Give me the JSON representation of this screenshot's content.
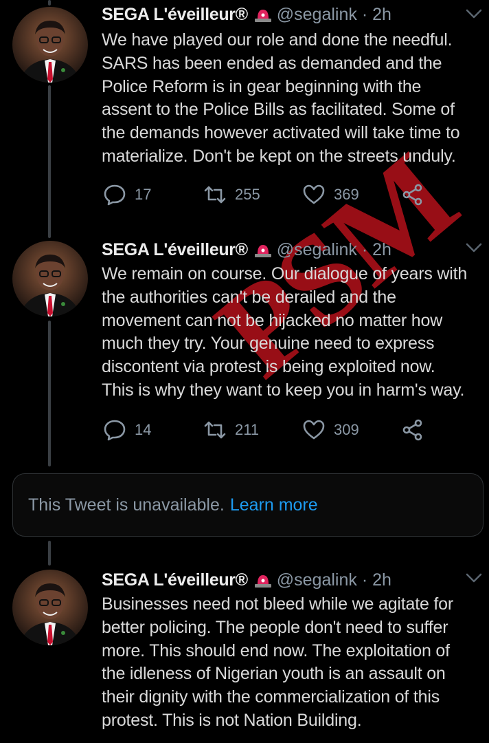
{
  "tweets": [
    {
      "name": "SEGA L'éveilleur®",
      "handle": "@segalink",
      "separator": "·",
      "time": "2h",
      "lines": [
        "We have played our role and done the needful.",
        "SARS has been ended as demanded and the",
        "Police Reform is in gear beginning with the",
        "assent to the Police Bills as facilitated. Some of",
        "the demands however activated will take time to",
        "materialize. Don't be kept on the streets unduly."
      ],
      "replies": "17",
      "retweets": "255",
      "likes": "369"
    },
    {
      "name": "SEGA L'éveilleur®",
      "handle": "@segalink",
      "separator": "·",
      "time": "2h",
      "lines": [
        "We remain on course. Our dialogue of years with",
        "the authorities can't be derailed and the",
        "movement can not be hijacked no matter how",
        "much they try. Your genuine need to express",
        "discontent via protest is being exploited now.",
        "This is why they want to keep you in harm's way."
      ],
      "replies": "14",
      "retweets": "211",
      "likes": "309"
    },
    {
      "name": "SEGA L'éveilleur®",
      "handle": "@segalink",
      "separator": "·",
      "time": "2h",
      "lines": [
        "Businesses need not bleed while we agitate for",
        "better policing. The people don't need to suffer",
        "more. This should end now. The exploitation of",
        "the idleness of Nigerian youth is an assault on",
        "their dignity with the commercialization of this",
        "protest. This is not Nation Building."
      ]
    }
  ],
  "unavailable": {
    "text": "This Tweet is unavailable.",
    "link": "Learn more"
  },
  "watermark": "PSM",
  "colors": {
    "background": "#000000",
    "text": "#d9d9d9",
    "muted": "#8b98a5",
    "link": "#1d9bf0",
    "badge": "#e0245e",
    "watermark": "#d2141e"
  },
  "icons": [
    "reply-icon",
    "retweet-icon",
    "like-icon",
    "share-icon",
    "siren-emoji-icon",
    "caret-down-icon"
  ]
}
